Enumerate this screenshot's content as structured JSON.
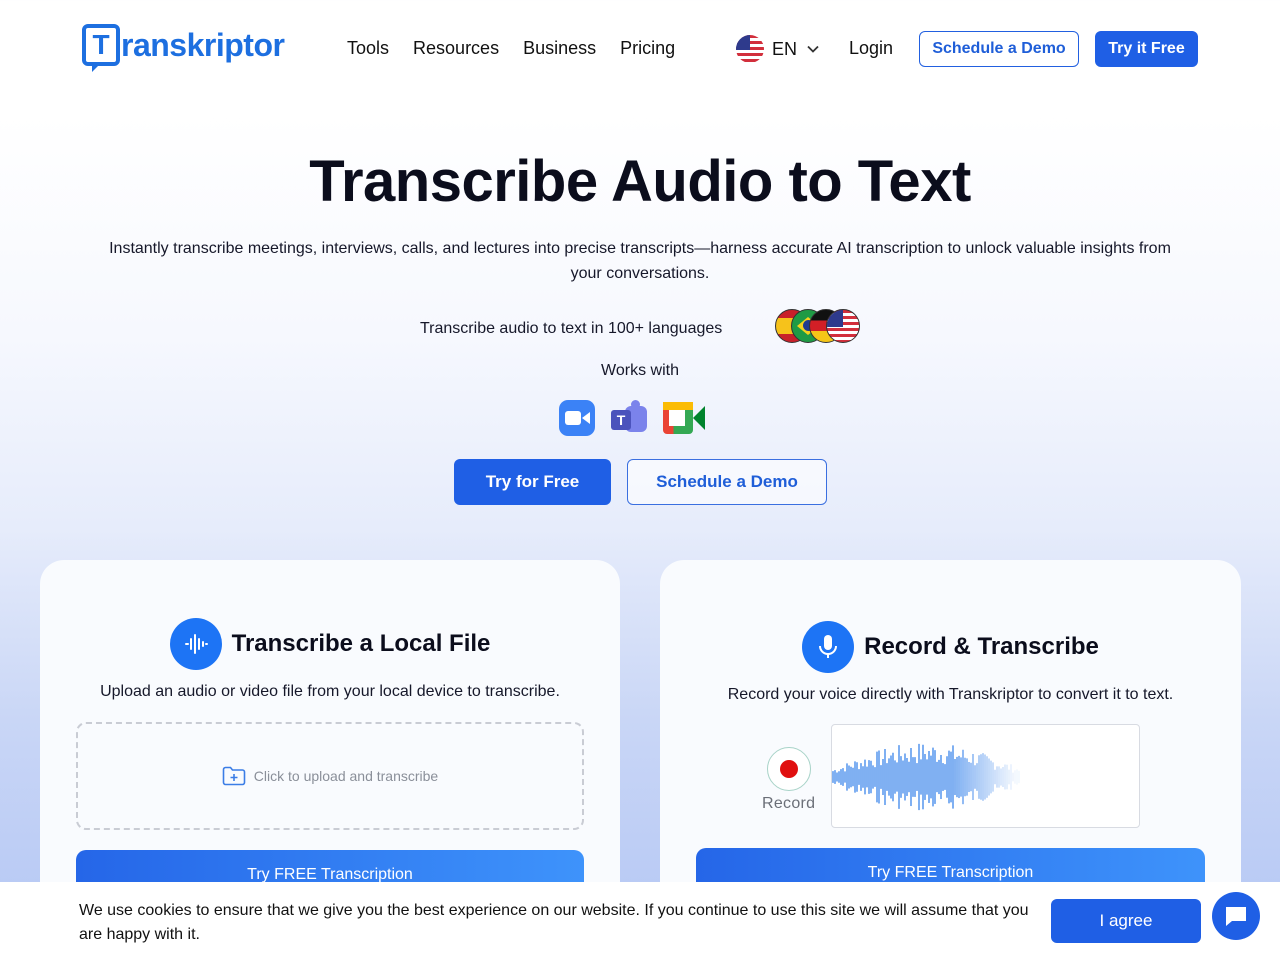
{
  "brand": {
    "logo_letter": "T",
    "logo_rest": "ranskriptor"
  },
  "nav": {
    "items": [
      {
        "label": "Tools"
      },
      {
        "label": "Resources"
      },
      {
        "label": "Business"
      },
      {
        "label": "Pricing"
      }
    ],
    "language": "EN",
    "login": "Login",
    "schedule_demo": "Schedule a Demo",
    "try_free": "Try it Free"
  },
  "hero": {
    "title": "Transcribe Audio to Text",
    "subtitle": "Instantly transcribe meetings, interviews, calls, and lectures into precise transcripts—harness accurate AI transcription to unlock valuable insights from your conversations.",
    "languages_line": "Transcribe audio to text in 100+ languages",
    "works_with": "Works with",
    "apps": [
      "zoom-icon",
      "microsoft-teams-icon",
      "google-meet-icon"
    ],
    "try_button": "Try for Free",
    "demo_button": "Schedule a Demo"
  },
  "cards": {
    "local": {
      "title": "Transcribe a Local File",
      "description": "Upload an audio or video file from your local device to transcribe.",
      "upload_text": "Click to upload and transcribe",
      "button": "Try FREE Transcription"
    },
    "record": {
      "title": "Record & Transcribe",
      "description": "Record your voice directly with Transkriptor to convert it to text.",
      "record_label": "Record",
      "button": "Try FREE Transcription"
    }
  },
  "cookie": {
    "text": "We use cookies to ensure that we give you the best experience on our website. If you continue to use this site we will assume that you are happy with it.",
    "agree": "I agree"
  },
  "colors": {
    "brand_blue": "#1d6fe0",
    "button_blue": "#1f5fe5",
    "record_red": "#e00f0f"
  }
}
